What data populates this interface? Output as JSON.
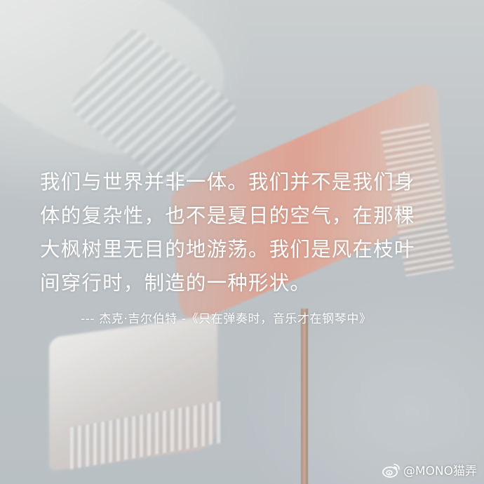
{
  "quote": {
    "lines": [
      "我们与世界并非一体。我们并不是我们身",
      "体的复杂性，也不是夏日的空气，在那棵",
      "大枫树里无目的地游荡。我们是风在枝叶",
      "间穿行时，制造的一种形状。"
    ]
  },
  "attribution": "--- 杰克·吉尔伯特 -《只在弹奏时，音乐才在钢琴中》",
  "watermark": {
    "icon": "weibo-icon",
    "handle": "@MONO猫弄"
  },
  "colors": {
    "text": "#ffffff",
    "flag_pink": "#eca08c",
    "pole": "#c9a08a"
  }
}
